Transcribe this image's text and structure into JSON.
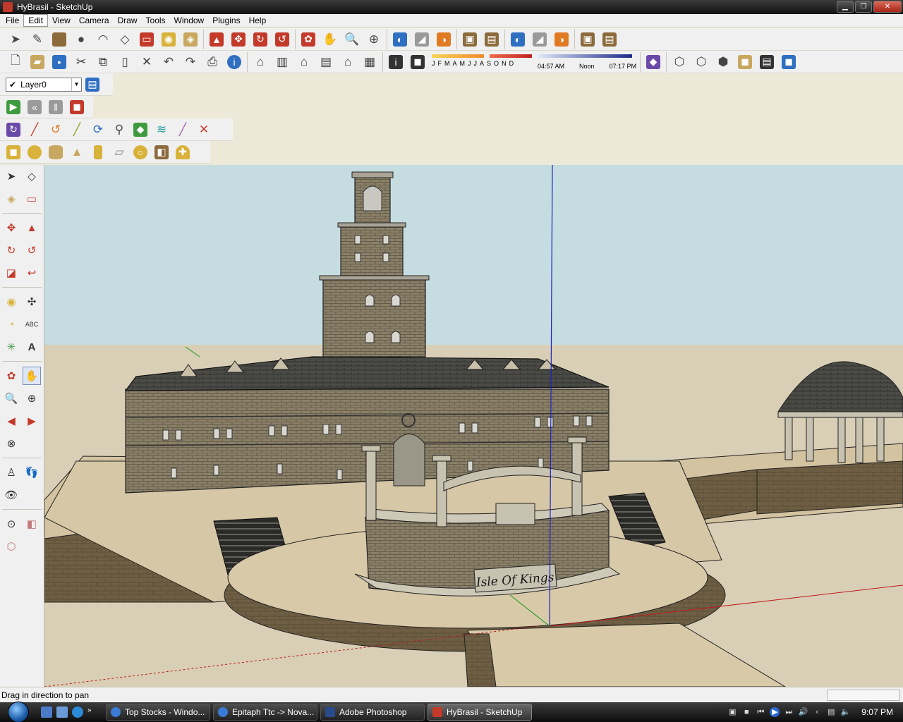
{
  "window": {
    "title": "HyBrasil - SketchUp"
  },
  "menu": [
    "File",
    "Edit",
    "View",
    "Camera",
    "Draw",
    "Tools",
    "Window",
    "Plugins",
    "Help"
  ],
  "shadow": {
    "months": [
      "J",
      "F",
      "M",
      "A",
      "M",
      "J",
      "J",
      "A",
      "S",
      "O",
      "N",
      "D"
    ],
    "time_start": "04:57 AM",
    "time_mid": "Noon",
    "time_end": "07:17 PM"
  },
  "layer": {
    "current": "Layer0"
  },
  "model": {
    "sign_text": "Isle Of Kings"
  },
  "status": {
    "text": "Drag in direction to pan"
  },
  "taskbar": {
    "tasks": [
      {
        "label": "Top Stocks - Windo...",
        "icon_color": "#3a7bd5"
      },
      {
        "label": "Epitaph Ttc -> Nova...",
        "icon_color": "#3a7bd5"
      },
      {
        "label": "Adobe Photoshop",
        "icon_color": "#2a4a8a"
      },
      {
        "label": "HyBrasil - SketchUp",
        "icon_color": "#c43a2a"
      }
    ],
    "clock": "9:07 PM"
  }
}
